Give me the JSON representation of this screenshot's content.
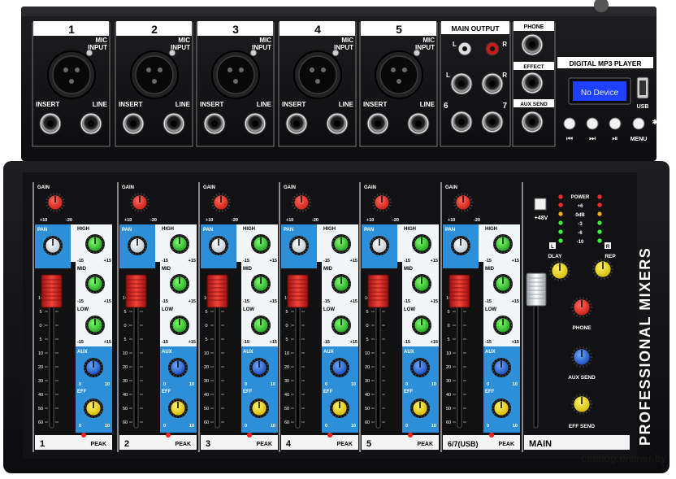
{
  "watermark": "catalog.onliner.by",
  "brand_vertical": "PROFESSIONAL MIXERS",
  "top_labels": {
    "mic_input": "MIC INPUT",
    "insert": "INSERT",
    "line": "LINE",
    "main_output": "MAIN OUTPUT",
    "phone": "PHONE",
    "effect": "EFFECT",
    "aux_send": "AUX SEND",
    "mp3_player": "DIGITAL MP3 PLAYER",
    "display_text": "No Device",
    "usb": "USB",
    "menu": "MENU",
    "l": "L",
    "r": "R",
    "six": "6",
    "seven": "7"
  },
  "top_channels": [
    "1",
    "2",
    "3",
    "4",
    "5"
  ],
  "strip_labels": {
    "gain": "GAIN",
    "pan": "PAN",
    "high": "HIGH",
    "mid": "MID",
    "low": "LOW",
    "aux": "AUX",
    "eff": "EFF",
    "peak": "PEAK",
    "eq_min": "-15",
    "eq_max": "+15",
    "zero": "0",
    "ten": "10",
    "gain_min": "+10",
    "gain_max": "-20"
  },
  "channel_numbers": [
    "1",
    "2",
    "3",
    "4",
    "5",
    "6/7(USB)"
  ],
  "fader_scale": [
    "10",
    "5",
    "0",
    "5",
    "10",
    "20",
    "30",
    "40",
    "50",
    "60"
  ],
  "master": {
    "power": "POWER",
    "phantom": "+48V",
    "meter_labels": [
      "+6",
      "0dB",
      "-3",
      "-6",
      "-10"
    ],
    "dly": "DLAY",
    "rep": "REP",
    "phone": "PHONE",
    "aux_send": "AUX SEND",
    "eff_send": "EFF SEND",
    "main": "MAIN",
    "l": "L",
    "r": "R"
  }
}
